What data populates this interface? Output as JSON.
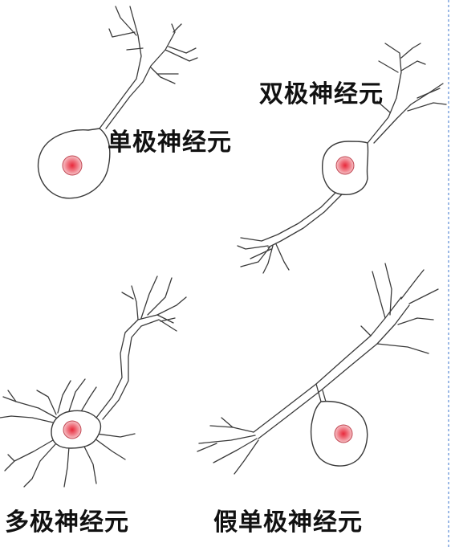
{
  "labels": {
    "unipolar": "单极神经元",
    "bipolar": "双极神经元",
    "multipolar": "多极神经元",
    "pseudounipolar": "假单极神经元"
  },
  "colors": {
    "outline": "#3a3a3a",
    "nucleus_center": "#e8283a",
    "nucleus_edge": "#f6c3c8",
    "label_text": "#111111",
    "border_dash": "#5b8bd6"
  }
}
